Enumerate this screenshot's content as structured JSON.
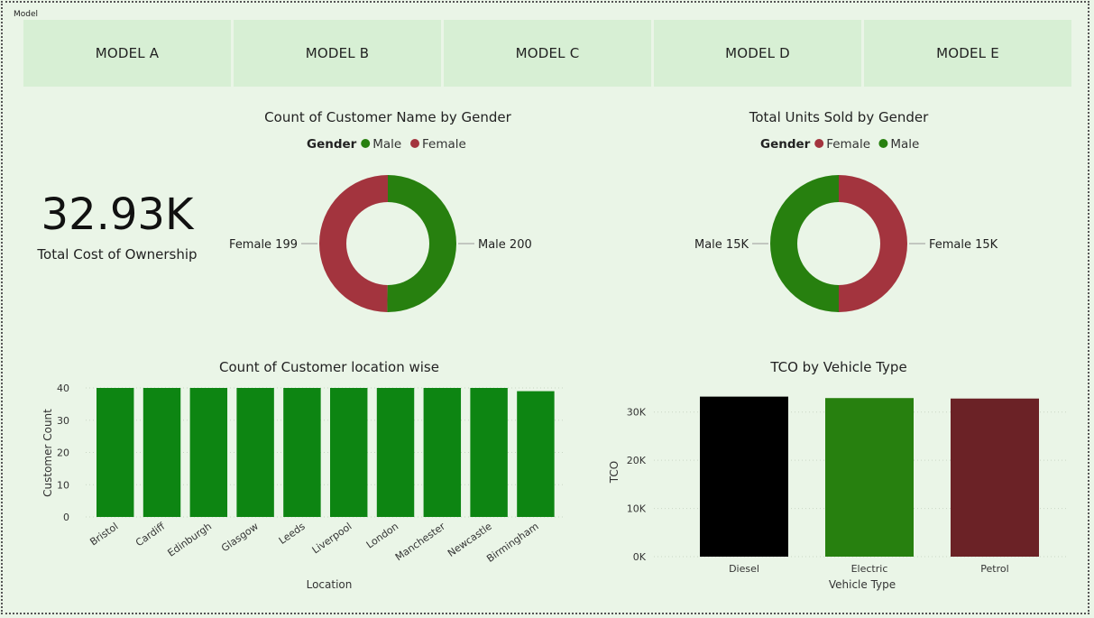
{
  "page": {
    "frame_label": "Model"
  },
  "slicer": {
    "items": [
      "MODEL A",
      "MODEL B",
      "MODEL C",
      "MODEL D",
      "MODEL E"
    ]
  },
  "kpi": {
    "value": "32.93K",
    "label": "Total Cost of Ownership"
  },
  "colors": {
    "male": "#27800f",
    "female": "#a3343e",
    "bar_green": "#0d8512",
    "diesel": "#000000",
    "electric": "#27800f",
    "petrol": "#6b2226"
  },
  "chart_data": [
    {
      "type": "pie",
      "title": "Count of Customer Name by Gender",
      "legend_title": "Gender",
      "legend_position": "top",
      "donut": true,
      "slices": [
        {
          "name": "Male",
          "value": 200,
          "label": "Male 200",
          "color": "#27800f"
        },
        {
          "name": "Female",
          "value": 199,
          "label": "Female 199",
          "color": "#a3343e"
        }
      ]
    },
    {
      "type": "pie",
      "title": "Total Units Sold by Gender",
      "legend_title": "Gender",
      "legend_position": "top",
      "donut": true,
      "slices": [
        {
          "name": "Female",
          "value": 15,
          "label": "Female 15K",
          "color": "#a3343e"
        },
        {
          "name": "Male",
          "value": 15,
          "label": "Male 15K",
          "color": "#27800f"
        }
      ]
    },
    {
      "type": "bar",
      "title": "Count of Customer location wise",
      "xlabel": "Location",
      "ylabel": "Customer Count",
      "categories": [
        "Bristol",
        "Cardiff",
        "Edinburgh",
        "Glasgow",
        "Leeds",
        "Liverpool",
        "London",
        "Manchester",
        "Newcastle",
        "Birmingham"
      ],
      "values": [
        40,
        40,
        40,
        40,
        40,
        40,
        40,
        40,
        40,
        39
      ],
      "ylim": [
        0,
        40
      ],
      "yticks": [
        "0",
        "10",
        "20",
        "30",
        "40"
      ],
      "grid": true
    },
    {
      "type": "bar",
      "title": "TCO by Vehicle Type",
      "xlabel": "Vehicle Type",
      "ylabel": "TCO",
      "categories": [
        "Diesel",
        "Electric",
        "Petrol"
      ],
      "values": [
        33200,
        32900,
        32800
      ],
      "colors": [
        "#000000",
        "#27800f",
        "#6b2226"
      ],
      "ylim": [
        0,
        35000
      ],
      "yticks": [
        "0K",
        "10K",
        "20K",
        "30K"
      ],
      "grid": true
    }
  ]
}
